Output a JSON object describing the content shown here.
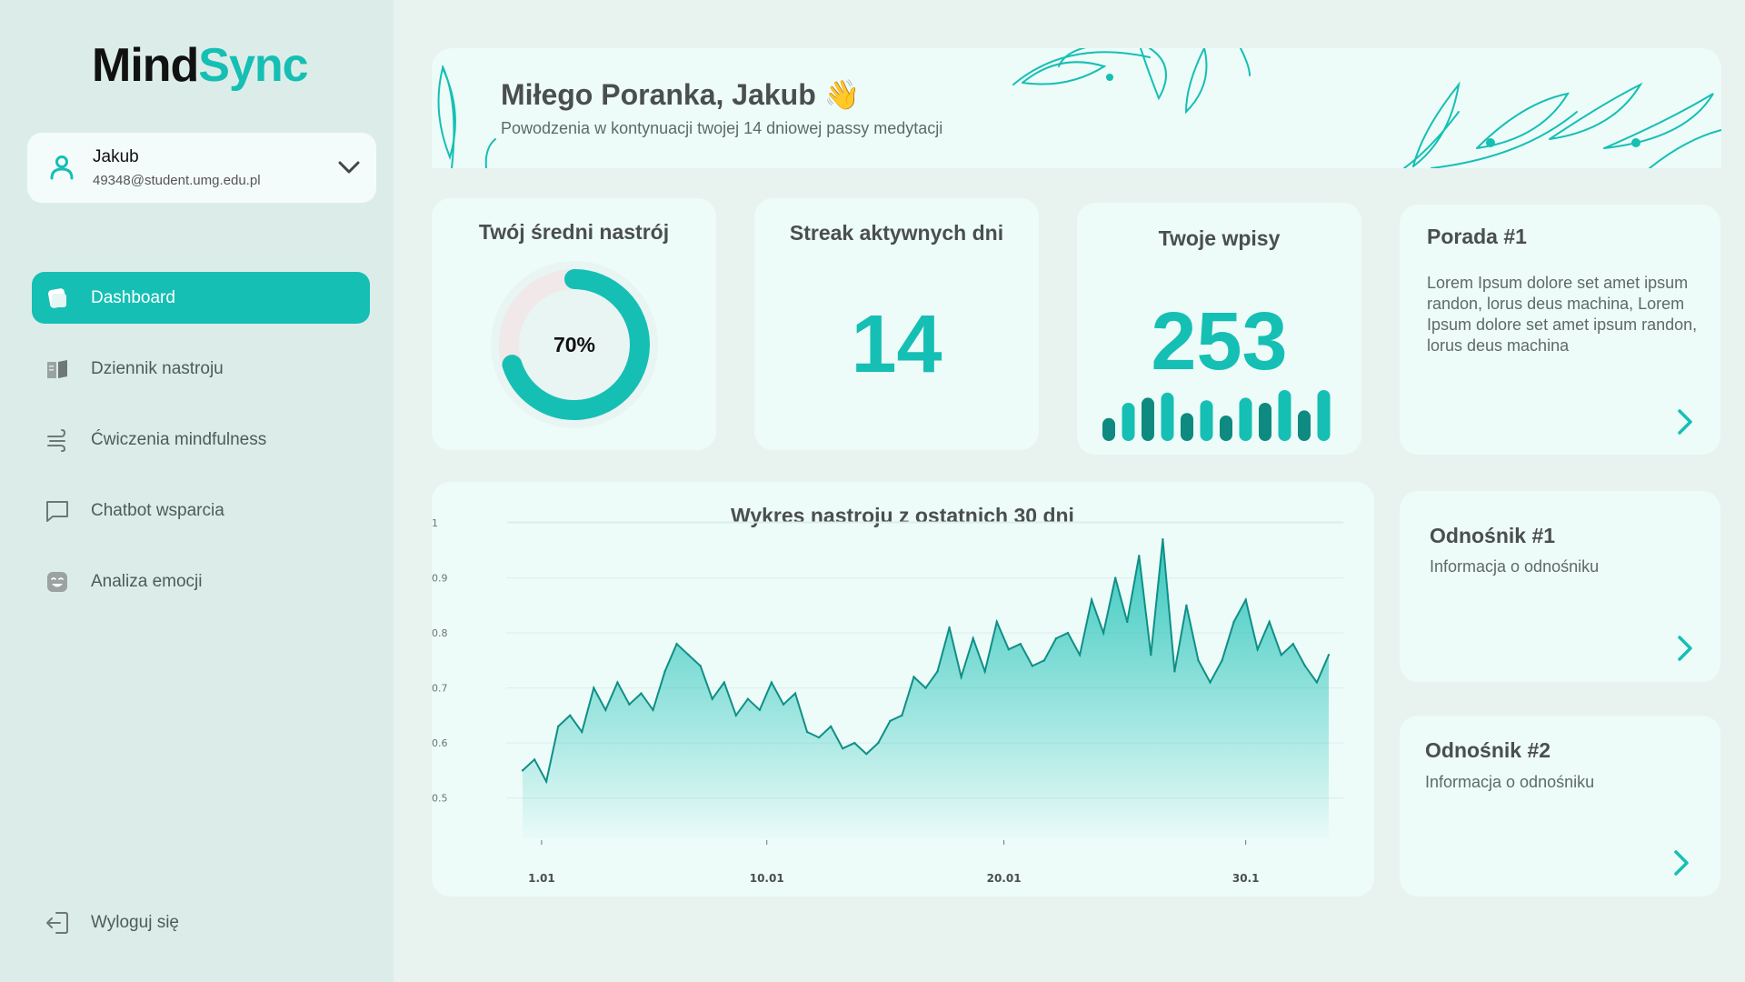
{
  "brand": {
    "part1": "Mind",
    "part2": "Sync"
  },
  "user": {
    "name": "Jakub",
    "email": "49348@student.umg.edu.pl"
  },
  "nav": [
    {
      "label": "Dashboard",
      "icon": "dashboard-icon",
      "active": true
    },
    {
      "label": "Dziennik nastroju",
      "icon": "book-icon",
      "active": false
    },
    {
      "label": "Ćwiczenia mindfulness",
      "icon": "wind-icon",
      "active": false
    },
    {
      "label": "Chatbot wsparcia",
      "icon": "chat-icon",
      "active": false
    },
    {
      "label": "Analiza emocji",
      "icon": "emotion-icon",
      "active": false
    }
  ],
  "logout_label": "Wyloguj się",
  "banner": {
    "greeting": "Miłego Poranka, Jakub 👋",
    "subtitle": "Powodzenia w kontynuacji twojej 14 dniowej passy medytacji"
  },
  "mood_card": {
    "title": "Twój średni nastrój",
    "value_label": "70%",
    "value": 0.7
  },
  "streak_card": {
    "title": "Streak aktywnych dni",
    "value": "14"
  },
  "entries_card": {
    "title": "Twoje wpisy",
    "value": "253",
    "bars": [
      0.45,
      0.75,
      0.85,
      0.95,
      0.55,
      0.8,
      0.5,
      0.85,
      0.75,
      1.0,
      0.6,
      1.0
    ]
  },
  "tip_card": {
    "title": "Porada #1",
    "text": "Lorem Ipsum dolore set amet ipsum randon, lorus deus machina, Lorem Ipsum dolore set amet ipsum randon, lorus deus machina"
  },
  "link1": {
    "title": "Odnośnik #1",
    "text": "Informacja o odnośniku"
  },
  "link2": {
    "title": "Odnośnik #2",
    "text": "Informacja o odnośniku"
  },
  "colors": {
    "accent": "#16bfb4",
    "accent_dark": "#0e8a80",
    "line": "#0f8f86"
  },
  "chart_data": {
    "type": "area",
    "title": "Wykres nastroju z ostatnich 30 dni",
    "xlabel": "",
    "ylabel": "",
    "x_ticks": [
      "1.01",
      "10.01",
      "20.01",
      "30.1"
    ],
    "y_ticks": [
      "1",
      "0.9",
      "0.8",
      "0.7",
      "0.6",
      "0.5"
    ],
    "ylim": [
      0.43,
      1.0
    ],
    "xlim": [
      -0.5,
      34.5
    ],
    "x": [
      0,
      0.5,
      1,
      1.5,
      2,
      2.5,
      3,
      3.5,
      4,
      4.5,
      5,
      5.5,
      6,
      6.5,
      7,
      7.5,
      8,
      8.5,
      9,
      9.5,
      10,
      10.5,
      11,
      11.5,
      12,
      12.5,
      13,
      13.5,
      14,
      14.5,
      15,
      15.5,
      16,
      16.5,
      17,
      17.5,
      18,
      18.5,
      19,
      19.5,
      20,
      20.5,
      21,
      21.5,
      22,
      22.5,
      23,
      23.5,
      24,
      24.5,
      25,
      25.5,
      26,
      26.5,
      27,
      27.5,
      28,
      28.5,
      29,
      29.5,
      30,
      30.5,
      31,
      31.5,
      32,
      32.5,
      33,
      33.5,
      34
    ],
    "values": [
      0.55,
      0.57,
      0.53,
      0.63,
      0.65,
      0.62,
      0.7,
      0.66,
      0.71,
      0.67,
      0.69,
      0.66,
      0.73,
      0.78,
      0.76,
      0.74,
      0.68,
      0.71,
      0.65,
      0.68,
      0.66,
      0.71,
      0.67,
      0.69,
      0.62,
      0.61,
      0.63,
      0.59,
      0.6,
      0.58,
      0.6,
      0.64,
      0.65,
      0.72,
      0.7,
      0.73,
      0.81,
      0.72,
      0.79,
      0.73,
      0.82,
      0.77,
      0.78,
      0.74,
      0.75,
      0.79,
      0.8,
      0.76,
      0.86,
      0.8,
      0.9,
      0.82,
      0.94,
      0.76,
      0.97,
      0.73,
      0.85,
      0.75,
      0.71,
      0.75,
      0.82,
      0.86,
      0.77,
      0.82,
      0.76,
      0.78,
      0.74,
      0.71,
      0.76
    ],
    "grid": true
  }
}
